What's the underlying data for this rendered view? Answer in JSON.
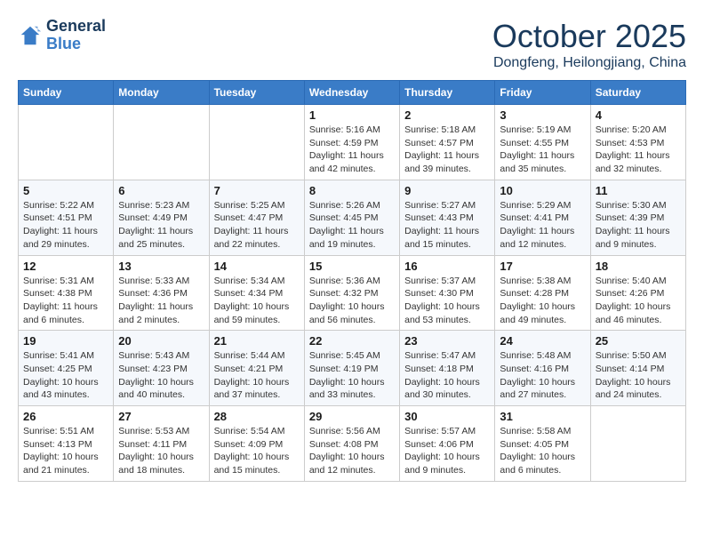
{
  "logo": {
    "line1": "General",
    "line2": "Blue"
  },
  "title": "October 2025",
  "location": "Dongfeng, Heilongjiang, China",
  "days_of_week": [
    "Sunday",
    "Monday",
    "Tuesday",
    "Wednesday",
    "Thursday",
    "Friday",
    "Saturday"
  ],
  "weeks": [
    [
      {
        "day": "",
        "info": ""
      },
      {
        "day": "",
        "info": ""
      },
      {
        "day": "",
        "info": ""
      },
      {
        "day": "1",
        "info": "Sunrise: 5:16 AM\nSunset: 4:59 PM\nDaylight: 11 hours\nand 42 minutes."
      },
      {
        "day": "2",
        "info": "Sunrise: 5:18 AM\nSunset: 4:57 PM\nDaylight: 11 hours\nand 39 minutes."
      },
      {
        "day": "3",
        "info": "Sunrise: 5:19 AM\nSunset: 4:55 PM\nDaylight: 11 hours\nand 35 minutes."
      },
      {
        "day": "4",
        "info": "Sunrise: 5:20 AM\nSunset: 4:53 PM\nDaylight: 11 hours\nand 32 minutes."
      }
    ],
    [
      {
        "day": "5",
        "info": "Sunrise: 5:22 AM\nSunset: 4:51 PM\nDaylight: 11 hours\nand 29 minutes."
      },
      {
        "day": "6",
        "info": "Sunrise: 5:23 AM\nSunset: 4:49 PM\nDaylight: 11 hours\nand 25 minutes."
      },
      {
        "day": "7",
        "info": "Sunrise: 5:25 AM\nSunset: 4:47 PM\nDaylight: 11 hours\nand 22 minutes."
      },
      {
        "day": "8",
        "info": "Sunrise: 5:26 AM\nSunset: 4:45 PM\nDaylight: 11 hours\nand 19 minutes."
      },
      {
        "day": "9",
        "info": "Sunrise: 5:27 AM\nSunset: 4:43 PM\nDaylight: 11 hours\nand 15 minutes."
      },
      {
        "day": "10",
        "info": "Sunrise: 5:29 AM\nSunset: 4:41 PM\nDaylight: 11 hours\nand 12 minutes."
      },
      {
        "day": "11",
        "info": "Sunrise: 5:30 AM\nSunset: 4:39 PM\nDaylight: 11 hours\nand 9 minutes."
      }
    ],
    [
      {
        "day": "12",
        "info": "Sunrise: 5:31 AM\nSunset: 4:38 PM\nDaylight: 11 hours\nand 6 minutes."
      },
      {
        "day": "13",
        "info": "Sunrise: 5:33 AM\nSunset: 4:36 PM\nDaylight: 11 hours\nand 2 minutes."
      },
      {
        "day": "14",
        "info": "Sunrise: 5:34 AM\nSunset: 4:34 PM\nDaylight: 10 hours\nand 59 minutes."
      },
      {
        "day": "15",
        "info": "Sunrise: 5:36 AM\nSunset: 4:32 PM\nDaylight: 10 hours\nand 56 minutes."
      },
      {
        "day": "16",
        "info": "Sunrise: 5:37 AM\nSunset: 4:30 PM\nDaylight: 10 hours\nand 53 minutes."
      },
      {
        "day": "17",
        "info": "Sunrise: 5:38 AM\nSunset: 4:28 PM\nDaylight: 10 hours\nand 49 minutes."
      },
      {
        "day": "18",
        "info": "Sunrise: 5:40 AM\nSunset: 4:26 PM\nDaylight: 10 hours\nand 46 minutes."
      }
    ],
    [
      {
        "day": "19",
        "info": "Sunrise: 5:41 AM\nSunset: 4:25 PM\nDaylight: 10 hours\nand 43 minutes."
      },
      {
        "day": "20",
        "info": "Sunrise: 5:43 AM\nSunset: 4:23 PM\nDaylight: 10 hours\nand 40 minutes."
      },
      {
        "day": "21",
        "info": "Sunrise: 5:44 AM\nSunset: 4:21 PM\nDaylight: 10 hours\nand 37 minutes."
      },
      {
        "day": "22",
        "info": "Sunrise: 5:45 AM\nSunset: 4:19 PM\nDaylight: 10 hours\nand 33 minutes."
      },
      {
        "day": "23",
        "info": "Sunrise: 5:47 AM\nSunset: 4:18 PM\nDaylight: 10 hours\nand 30 minutes."
      },
      {
        "day": "24",
        "info": "Sunrise: 5:48 AM\nSunset: 4:16 PM\nDaylight: 10 hours\nand 27 minutes."
      },
      {
        "day": "25",
        "info": "Sunrise: 5:50 AM\nSunset: 4:14 PM\nDaylight: 10 hours\nand 24 minutes."
      }
    ],
    [
      {
        "day": "26",
        "info": "Sunrise: 5:51 AM\nSunset: 4:13 PM\nDaylight: 10 hours\nand 21 minutes."
      },
      {
        "day": "27",
        "info": "Sunrise: 5:53 AM\nSunset: 4:11 PM\nDaylight: 10 hours\nand 18 minutes."
      },
      {
        "day": "28",
        "info": "Sunrise: 5:54 AM\nSunset: 4:09 PM\nDaylight: 10 hours\nand 15 minutes."
      },
      {
        "day": "29",
        "info": "Sunrise: 5:56 AM\nSunset: 4:08 PM\nDaylight: 10 hours\nand 12 minutes."
      },
      {
        "day": "30",
        "info": "Sunrise: 5:57 AM\nSunset: 4:06 PM\nDaylight: 10 hours\nand 9 minutes."
      },
      {
        "day": "31",
        "info": "Sunrise: 5:58 AM\nSunset: 4:05 PM\nDaylight: 10 hours\nand 6 minutes."
      },
      {
        "day": "",
        "info": ""
      }
    ]
  ]
}
